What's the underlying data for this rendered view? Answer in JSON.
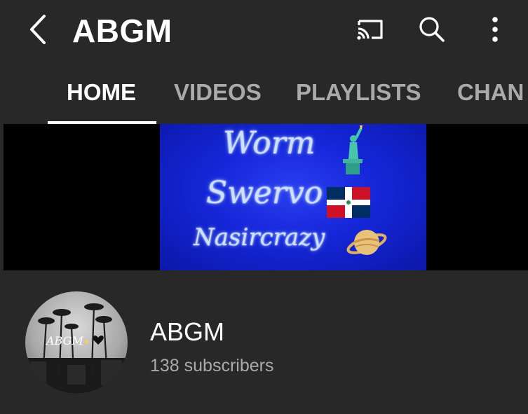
{
  "header": {
    "title": "ABGM",
    "back_icon": "back-arrow-icon",
    "cast_icon": "cast-icon",
    "search_icon": "search-icon",
    "more_icon": "more-vert-icon"
  },
  "tabs": [
    {
      "label": "HOME",
      "active": true
    },
    {
      "label": "VIDEOS",
      "active": false
    },
    {
      "label": "PLAYLISTS",
      "active": false
    },
    {
      "label": "CHAN",
      "active": false
    }
  ],
  "banner": {
    "lines": [
      "Worm",
      "Swervo",
      "Nasircrazy"
    ],
    "background_color": "#1526d8"
  },
  "channel": {
    "avatar_text": "ABGM",
    "name": "ABGM",
    "subscribers": "138 subscribers"
  },
  "colors": {
    "background": "#282828",
    "text_primary": "#ffffff",
    "text_secondary": "#aaaaaa"
  }
}
